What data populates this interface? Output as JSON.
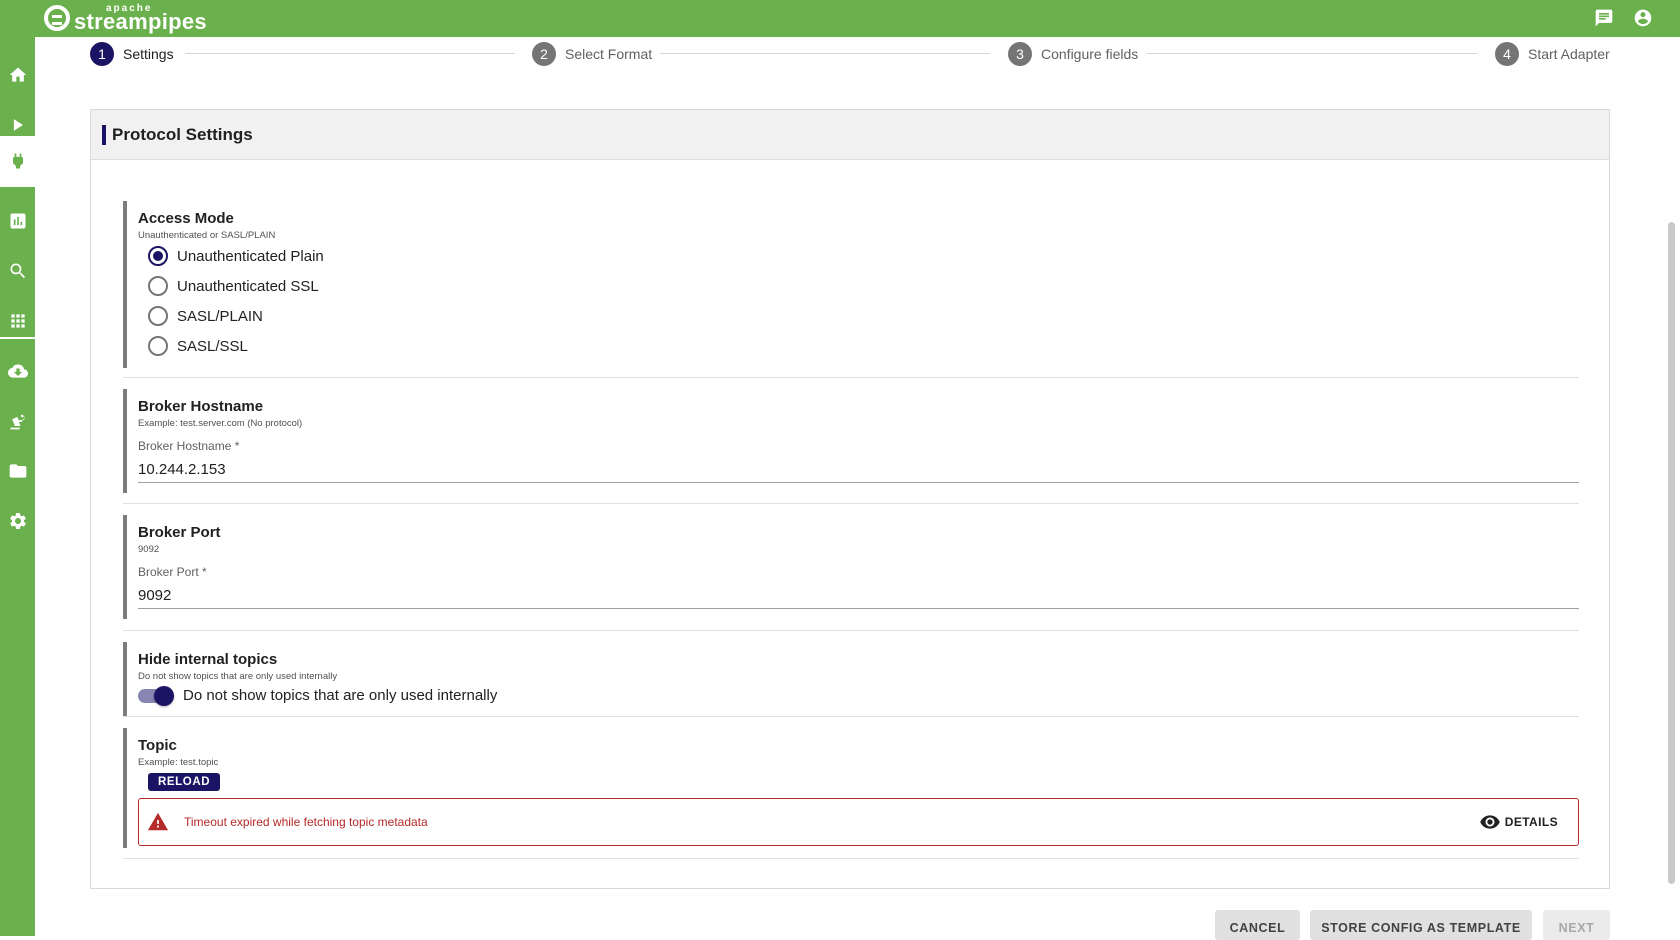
{
  "brand": {
    "small": "apache",
    "name": "streampipes"
  },
  "topbar": {
    "icons": [
      "notifications-icon",
      "account-icon"
    ]
  },
  "sidebar": {
    "items": [
      "home-icon",
      "pipeline-icon",
      "connect-icon",
      "dashboard-icon",
      "data-explorer-icon",
      "apps-icon",
      "install-icon",
      "assets-icon",
      "files-icon",
      "settings-icon"
    ],
    "active": "connect-icon"
  },
  "stepper": {
    "steps": [
      {
        "num": "1",
        "label": "Settings",
        "active": true
      },
      {
        "num": "2",
        "label": "Select Format",
        "active": false
      },
      {
        "num": "3",
        "label": "Configure fields",
        "active": false
      },
      {
        "num": "4",
        "label": "Start Adapter",
        "active": false
      }
    ]
  },
  "card": {
    "title": "Protocol Settings"
  },
  "access_mode": {
    "title": "Access Mode",
    "desc": "Unauthenticated or SASL/PLAIN",
    "options": [
      "Unauthenticated Plain",
      "Unauthenticated SSL",
      "SASL/PLAIN",
      "SASL/SSL"
    ],
    "selected": "Unauthenticated Plain"
  },
  "broker_hostname": {
    "title": "Broker Hostname",
    "desc": "Example: test.server.com (No protocol)",
    "label": "Broker Hostname *",
    "value": "10.244.2.153"
  },
  "broker_port": {
    "title": "Broker Port",
    "desc": "9092",
    "label": "Broker Port *",
    "value": "9092"
  },
  "hide_topics": {
    "title": "Hide internal topics",
    "desc": "Do not show topics that are only used internally",
    "toggle_label": "Do not show topics that are only used internally",
    "enabled": true
  },
  "topic": {
    "title": "Topic",
    "desc": "Example: test.topic",
    "reload_label": "RELOAD",
    "error_text": "Timeout expired while fetching topic metadata",
    "details_label": "DETAILS"
  },
  "actions": {
    "cancel": "CANCEL",
    "store": "STORE CONFIG AS TEMPLATE",
    "next": "NEXT"
  },
  "colors": {
    "brand_green": "#6ab04c",
    "primary": "#1b1464",
    "error": "#b52a2a"
  }
}
